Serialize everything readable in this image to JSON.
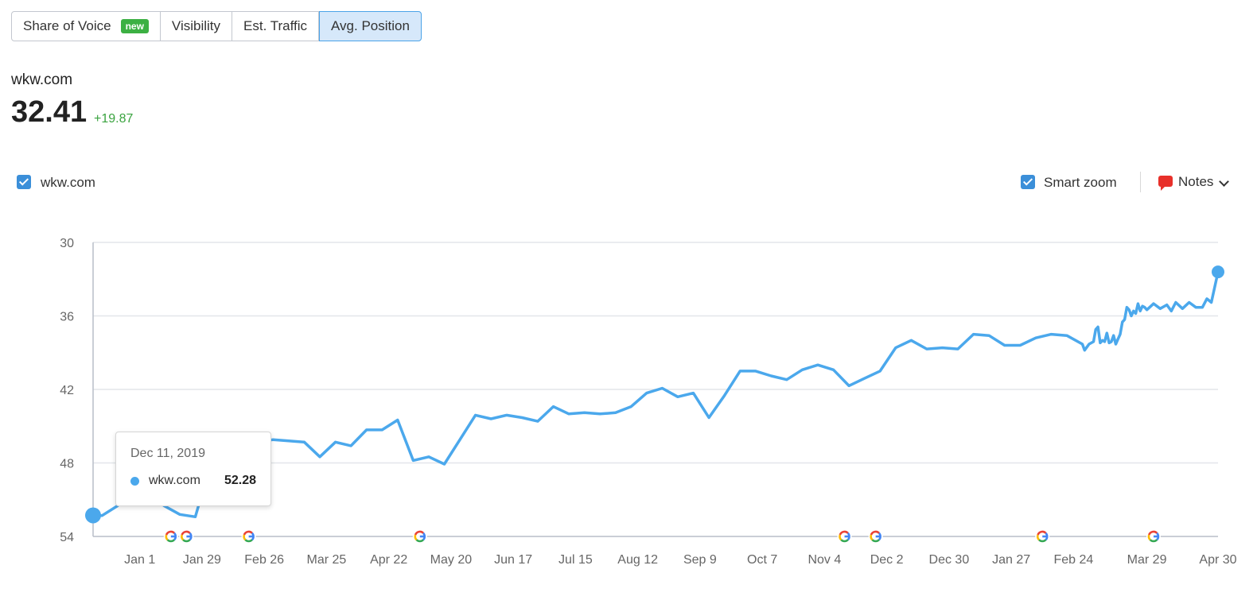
{
  "tabs": [
    {
      "label": "Share of Voice",
      "badge": "new"
    },
    {
      "label": "Visibility"
    },
    {
      "label": "Est. Traffic"
    },
    {
      "label": "Avg. Position",
      "active": true
    }
  ],
  "summary": {
    "domain": "wkw.com",
    "value": "32.41",
    "delta": "+19.87"
  },
  "legend": {
    "series_label": "wkw.com"
  },
  "controls": {
    "smart_zoom": "Smart zoom",
    "notes": "Notes"
  },
  "colors": {
    "line": "#4ba8ec",
    "accent": "#3b8fd9",
    "positive": "#3aa33f",
    "notes": "#e8302a"
  },
  "tooltip": {
    "date": "Dec 11, 2019",
    "series": "wkw.com",
    "value": "52.28"
  },
  "chart_data": {
    "type": "line",
    "y_axis": {
      "ticks": [
        30,
        36,
        42,
        48,
        54
      ],
      "range": [
        30,
        54
      ],
      "inverted": true
    },
    "x_tick_labels": [
      "Jan 1",
      "Jan 29",
      "Feb 26",
      "Mar 25",
      "Apr 22",
      "May 20",
      "Jun 17",
      "Jul 15",
      "Aug 12",
      "Sep 9",
      "Oct 7",
      "Nov 4",
      "Dec 2",
      "Dec 30",
      "Jan 27",
      "Feb 24",
      "Mar 29",
      "Apr 30"
    ],
    "grid": true,
    "google_update_markers": [
      "Jan 15",
      "Jan 22",
      "Feb 19",
      "May 6",
      "Nov 13",
      "Nov 27",
      "Feb 10",
      "Apr 1"
    ],
    "series": [
      {
        "name": "wkw.com",
        "points": [
          [
            "Dec 11",
            52.28
          ],
          [
            "Dec 15",
            52.3
          ],
          [
            "Dec 22",
            51.5
          ],
          [
            "Dec 29",
            50.3
          ],
          [
            "Jan 5",
            50.5
          ],
          [
            "Jan 12",
            51.5
          ],
          [
            "Jan 19",
            52.2
          ],
          [
            "Jan 26",
            52.4
          ],
          [
            "Feb 2",
            48.0
          ],
          [
            "Feb 9",
            47.4
          ],
          [
            "Feb 16",
            46.8
          ],
          [
            "Feb 23",
            46.3
          ],
          [
            "Mar 1",
            46.1
          ],
          [
            "Mar 8",
            46.2
          ],
          [
            "Mar 15",
            46.3
          ],
          [
            "Mar 22",
            47.5
          ],
          [
            "Mar 29",
            46.3
          ],
          [
            "Apr 5",
            46.6
          ],
          [
            "Apr 12",
            45.3
          ],
          [
            "Apr 19",
            45.3
          ],
          [
            "Apr 26",
            44.5
          ],
          [
            "May 3",
            47.8
          ],
          [
            "May 10",
            47.5
          ],
          [
            "May 17",
            48.1
          ],
          [
            "May 24",
            46.1
          ],
          [
            "May 31",
            44.1
          ],
          [
            "Jun 7",
            44.4
          ],
          [
            "Jun 14",
            44.1
          ],
          [
            "Jun 21",
            44.3
          ],
          [
            "Jun 28",
            44.6
          ],
          [
            "Jul 5",
            43.4
          ],
          [
            "Jul 12",
            44.0
          ],
          [
            "Jul 19",
            43.9
          ],
          [
            "Jul 26",
            44.0
          ],
          [
            "Aug 2",
            43.9
          ],
          [
            "Aug 9",
            43.4
          ],
          [
            "Aug 16",
            42.3
          ],
          [
            "Aug 23",
            41.9
          ],
          [
            "Aug 30",
            42.6
          ],
          [
            "Sep 6",
            42.3
          ],
          [
            "Sep 13",
            44.3
          ],
          [
            "Sep 20",
            42.5
          ],
          [
            "Sep 27",
            40.5
          ],
          [
            "Oct 4",
            40.5
          ],
          [
            "Oct 11",
            40.9
          ],
          [
            "Oct 18",
            41.2
          ],
          [
            "Oct 25",
            40.4
          ],
          [
            "Nov 1",
            40.0
          ],
          [
            "Nov 8",
            40.4
          ],
          [
            "Nov 15",
            41.7
          ],
          [
            "Nov 22",
            41.1
          ],
          [
            "Nov 29",
            40.5
          ],
          [
            "Dec 6",
            38.6
          ],
          [
            "Dec 13",
            38.0
          ],
          [
            "Dec 20",
            38.7
          ],
          [
            "Dec 27",
            38.6
          ],
          [
            "Jan 3",
            38.7
          ],
          [
            "Jan 10",
            37.5
          ],
          [
            "Jan 17",
            37.6
          ],
          [
            "Jan 24",
            38.4
          ],
          [
            "Jan 31",
            38.4
          ],
          [
            "Feb 7",
            37.8
          ],
          [
            "Feb 14",
            37.5
          ],
          [
            "Feb 21",
            37.6
          ],
          [
            "Feb 28",
            38.3
          ],
          [
            "Mar 1",
            38.8
          ],
          [
            "Mar 3",
            38.3
          ],
          [
            "Mar 5",
            38.1
          ],
          [
            "Mar 6",
            37.1
          ],
          [
            "Mar 7",
            36.9
          ],
          [
            "Mar 8",
            38.2
          ],
          [
            "Mar 9",
            38.0
          ],
          [
            "Mar 10",
            38.1
          ],
          [
            "Mar 11",
            37.4
          ],
          [
            "Mar 12",
            38.2
          ],
          [
            "Mar 13",
            38.1
          ],
          [
            "Mar 14",
            37.6
          ],
          [
            "Mar 15",
            38.3
          ],
          [
            "Mar 16",
            37.9
          ],
          [
            "Mar 17",
            37.5
          ],
          [
            "Mar 18",
            36.5
          ],
          [
            "Mar 19",
            36.3
          ],
          [
            "Mar 20",
            35.3
          ],
          [
            "Mar 21",
            35.5
          ],
          [
            "Mar 22",
            36.0
          ],
          [
            "Mar 23",
            35.6
          ],
          [
            "Mar 24",
            35.8
          ],
          [
            "Mar 25",
            35.0
          ],
          [
            "Mar 26",
            35.6
          ],
          [
            "Mar 27",
            35.2
          ],
          [
            "Mar 28",
            35.3
          ],
          [
            "Mar 29",
            35.5
          ],
          [
            "Apr 1",
            35.0
          ],
          [
            "Apr 4",
            35.4
          ],
          [
            "Apr 7",
            35.1
          ],
          [
            "Apr 9",
            35.6
          ],
          [
            "Apr 11",
            34.9
          ],
          [
            "Apr 14",
            35.4
          ],
          [
            "Apr 17",
            34.9
          ],
          [
            "Apr 20",
            35.3
          ],
          [
            "Apr 23",
            35.3
          ],
          [
            "Apr 25",
            34.6
          ],
          [
            "Apr 27",
            34.9
          ],
          [
            "Apr 30",
            32.41
          ]
        ]
      }
    ]
  }
}
